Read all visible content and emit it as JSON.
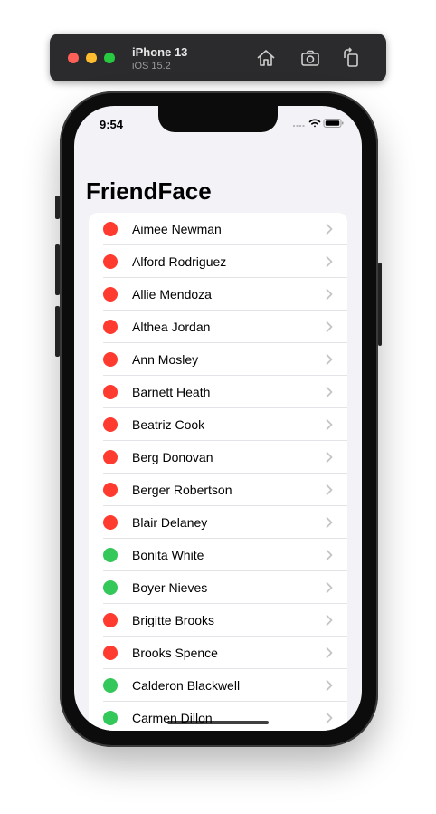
{
  "simulator": {
    "device": "iPhone 13",
    "os": "iOS 15.2",
    "buttons": [
      "home-icon",
      "screenshot-icon",
      "rotate-icon"
    ]
  },
  "status_bar": {
    "time": "9:54"
  },
  "app": {
    "title": "FriendFace"
  },
  "colors": {
    "active": "#34c759",
    "inactive": "#ff3b30"
  },
  "friends": [
    {
      "name": "Aimee Newman",
      "active": false
    },
    {
      "name": "Alford Rodriguez",
      "active": false
    },
    {
      "name": "Allie Mendoza",
      "active": false
    },
    {
      "name": "Althea Jordan",
      "active": false
    },
    {
      "name": "Ann Mosley",
      "active": false
    },
    {
      "name": "Barnett Heath",
      "active": false
    },
    {
      "name": "Beatriz Cook",
      "active": false
    },
    {
      "name": "Berg Donovan",
      "active": false
    },
    {
      "name": "Berger Robertson",
      "active": false
    },
    {
      "name": "Blair Delaney",
      "active": false
    },
    {
      "name": "Bonita White",
      "active": true
    },
    {
      "name": "Boyer Nieves",
      "active": true
    },
    {
      "name": "Brigitte Brooks",
      "active": false
    },
    {
      "name": "Brooks Spence",
      "active": false
    },
    {
      "name": "Calderon Blackwell",
      "active": true
    },
    {
      "name": "Carmen Dillon",
      "active": true
    }
  ]
}
